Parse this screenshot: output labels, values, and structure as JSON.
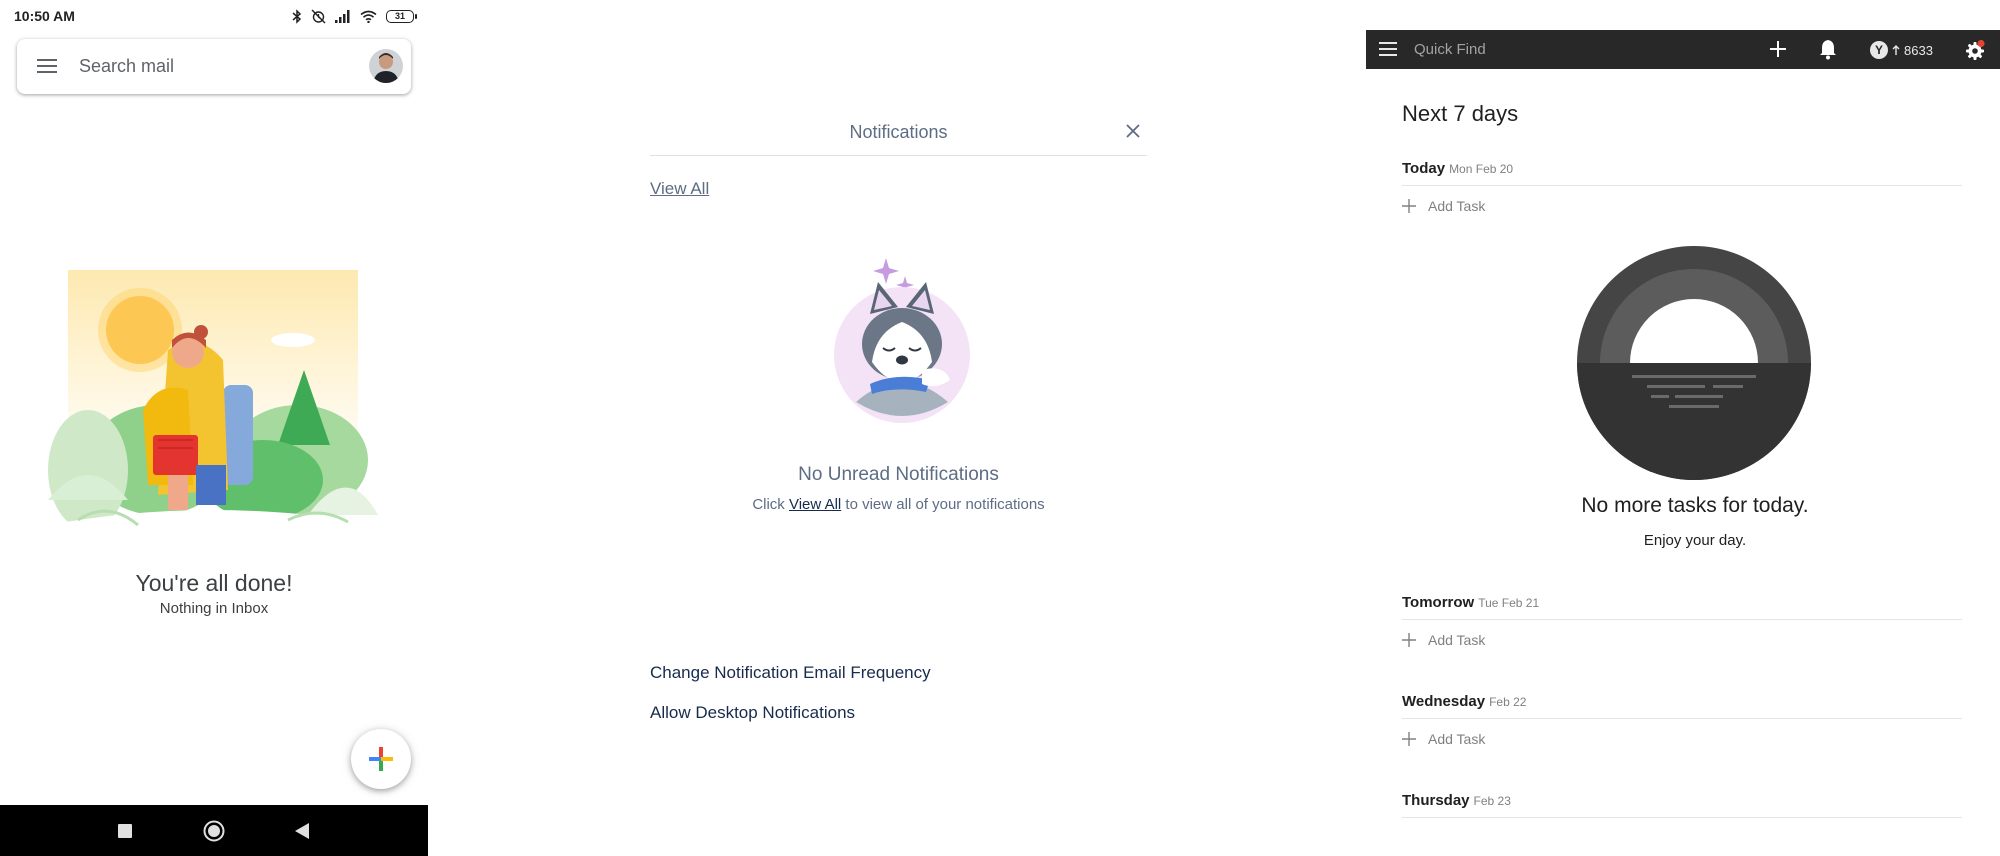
{
  "mail": {
    "status": {
      "time": "10:50 AM",
      "battery": "31"
    },
    "search": {
      "placeholder": "Search mail"
    },
    "empty": {
      "title": "You're all done!",
      "subtitle": "Nothing in Inbox"
    }
  },
  "notifications": {
    "title": "Notifications",
    "view_all": "View All",
    "empty_title": "No Unread Notifications",
    "empty_sub_before": "Click ",
    "empty_sub_link": "View All",
    "empty_sub_after": " to view all of your notifications",
    "links": [
      "Change Notification Email Frequency",
      "Allow Desktop Notifications"
    ]
  },
  "todo": {
    "search_placeholder": "Quick Find",
    "karma": "8633",
    "karma_badge": "Y",
    "heading": "Next 7 days",
    "add_task_label": "Add Task",
    "days": [
      {
        "name": "Today",
        "date": "Mon Feb 20"
      },
      {
        "name": "Tomorrow",
        "date": "Tue Feb 21"
      },
      {
        "name": "Wednesday",
        "date": "Feb 22"
      },
      {
        "name": "Thursday",
        "date": "Feb 23"
      }
    ],
    "empty_title": "No more tasks for today.",
    "empty_sub": "Enjoy your day."
  },
  "colors": {
    "todo_topbar": "#282828",
    "notif_text": "#5e6c84",
    "notif_link": "#172b4d",
    "gmail_blue": "#4285f4",
    "gmail_red": "#ea4335",
    "gmail_yellow": "#fbbc05",
    "gmail_green": "#34a853"
  }
}
